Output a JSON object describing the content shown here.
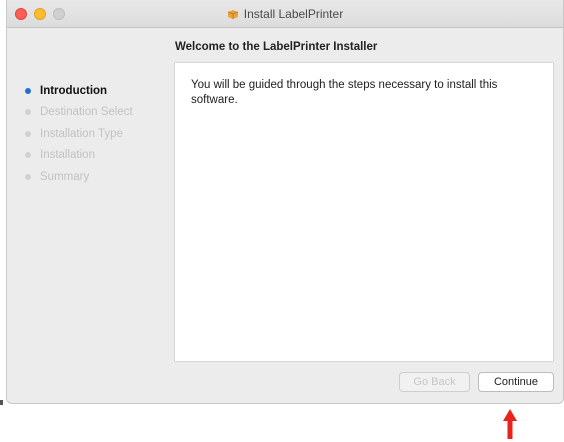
{
  "window": {
    "title": "Install LabelPrinter",
    "title_icon": "package-icon"
  },
  "main": {
    "heading": "Welcome to the LabelPrinter Installer",
    "body_text": "You will be guided through the steps necessary to install this software."
  },
  "sidebar": {
    "steps": [
      {
        "label": "Introduction",
        "active": true
      },
      {
        "label": "Destination Select",
        "active": false
      },
      {
        "label": "Installation Type",
        "active": false
      },
      {
        "label": "Installation",
        "active": false
      },
      {
        "label": "Summary",
        "active": false
      }
    ]
  },
  "buttons": {
    "back_label": "Go Back",
    "continue_label": "Continue"
  },
  "annotation": {
    "icon": "red-up-arrow-icon",
    "color": "#e8231b"
  },
  "colors": {
    "active_step_bullet": "#1f6fd6",
    "close_button": "#fe5f57",
    "minimize_button": "#febc2e"
  }
}
